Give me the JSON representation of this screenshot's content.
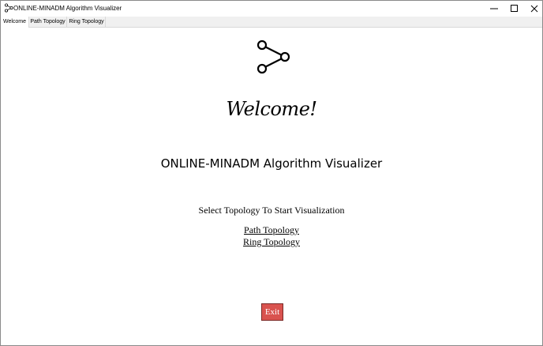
{
  "window": {
    "title": "ONLINE-MINADM Algorithm Visualizer",
    "controls": [
      "minimize-icon",
      "maximize-icon",
      "close-icon"
    ]
  },
  "tabs": [
    {
      "label": "Welcome",
      "active": true
    },
    {
      "label": "Path Topology",
      "active": false
    },
    {
      "label": "Ring Topology",
      "active": false
    }
  ],
  "main": {
    "icon": "share-icon",
    "heading": "Welcome!",
    "subtitle": "ONLINE-MINADM Algorithm Visualizer",
    "prompt": "Select Topology To Start Visualization",
    "links": [
      "Path Topology",
      "Ring Topology"
    ],
    "exit_label": "Exit"
  },
  "colors": {
    "exit_button": "#d9534f",
    "exit_text": "#ffffff",
    "tabbar_bg": "#f0f0f0"
  }
}
